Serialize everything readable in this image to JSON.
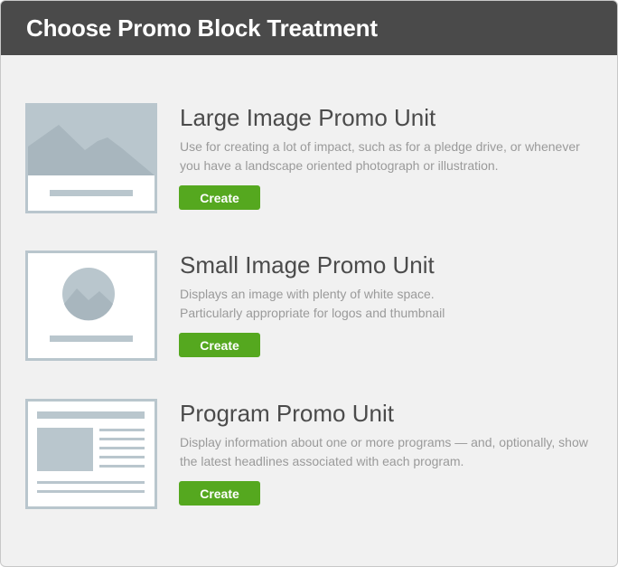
{
  "dialog": {
    "title": "Choose Promo Block Treatment"
  },
  "options": [
    {
      "title": "Large Image Promo Unit",
      "description": "Use for creating a lot of impact, such as for a pledge drive, or whenever you have a landscape oriented photograph or illustration.",
      "button_label": "Create",
      "icon": "large-image-thumbnail-icon"
    },
    {
      "title": "Small Image Promo Unit",
      "description": "Displays an image with plenty of white space.\nParticularly appropriate for logos and thumbnail",
      "button_label": "Create",
      "icon": "small-image-thumbnail-icon"
    },
    {
      "title": "Program Promo Unit",
      "description": "Display information about one or more programs — and, optionally, show the latest headlines associated with each program.",
      "button_label": "Create",
      "icon": "program-thumbnail-icon"
    }
  ],
  "colors": {
    "header_bg": "#4a4a4a",
    "panel_bg": "#f1f1f1",
    "button_green": "#55a81f",
    "thumbnail_blue_gray": "#b9c6cd"
  }
}
